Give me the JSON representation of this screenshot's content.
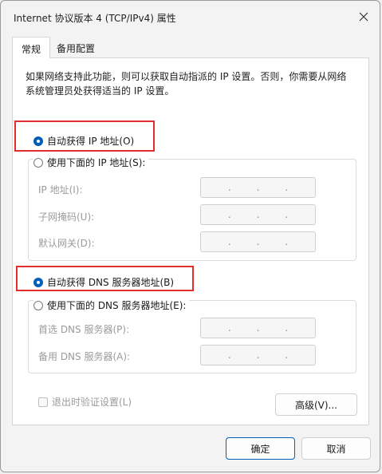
{
  "window": {
    "title": "Internet 协议版本 4 (TCP/IPv4) 属性",
    "close_icon": "close-icon"
  },
  "tabs": [
    {
      "label": "常规",
      "active": true
    },
    {
      "label": "备用配置",
      "active": false
    }
  ],
  "description": "如果网络支持此功能，则可以获取自动指派的 IP 设置。否则，你需要从网络系统管理员处获得适当的 IP 设置。",
  "ip_section": {
    "auto_option": {
      "label": "自动获得 IP 地址(O)",
      "checked": true
    },
    "manual_option": {
      "label": "使用下面的 IP 地址(S):",
      "checked": false
    },
    "fields": [
      {
        "label": "IP 地址(I):",
        "value": ". . ."
      },
      {
        "label": "子网掩码(U):",
        "value": ". . ."
      },
      {
        "label": "默认网关(D):",
        "value": ". . ."
      }
    ]
  },
  "dns_section": {
    "auto_option": {
      "label": "自动获得 DNS 服务器地址(B)",
      "checked": true
    },
    "manual_option": {
      "label": "使用下面的 DNS 服务器地址(E):",
      "checked": false
    },
    "fields": [
      {
        "label": "首选 DNS 服务器(P):",
        "value": ". . ."
      },
      {
        "label": "备用 DNS 服务器(A):",
        "value": ". . ."
      }
    ]
  },
  "validate_checkbox": {
    "label": "退出时验证设置(L)",
    "checked": false
  },
  "buttons": {
    "advanced": "高级(V)...",
    "ok": "确定",
    "cancel": "取消"
  },
  "colors": {
    "accent": "#005fb8",
    "highlight_box": "#e02d2d",
    "disabled_text": "#9b9b9b"
  }
}
